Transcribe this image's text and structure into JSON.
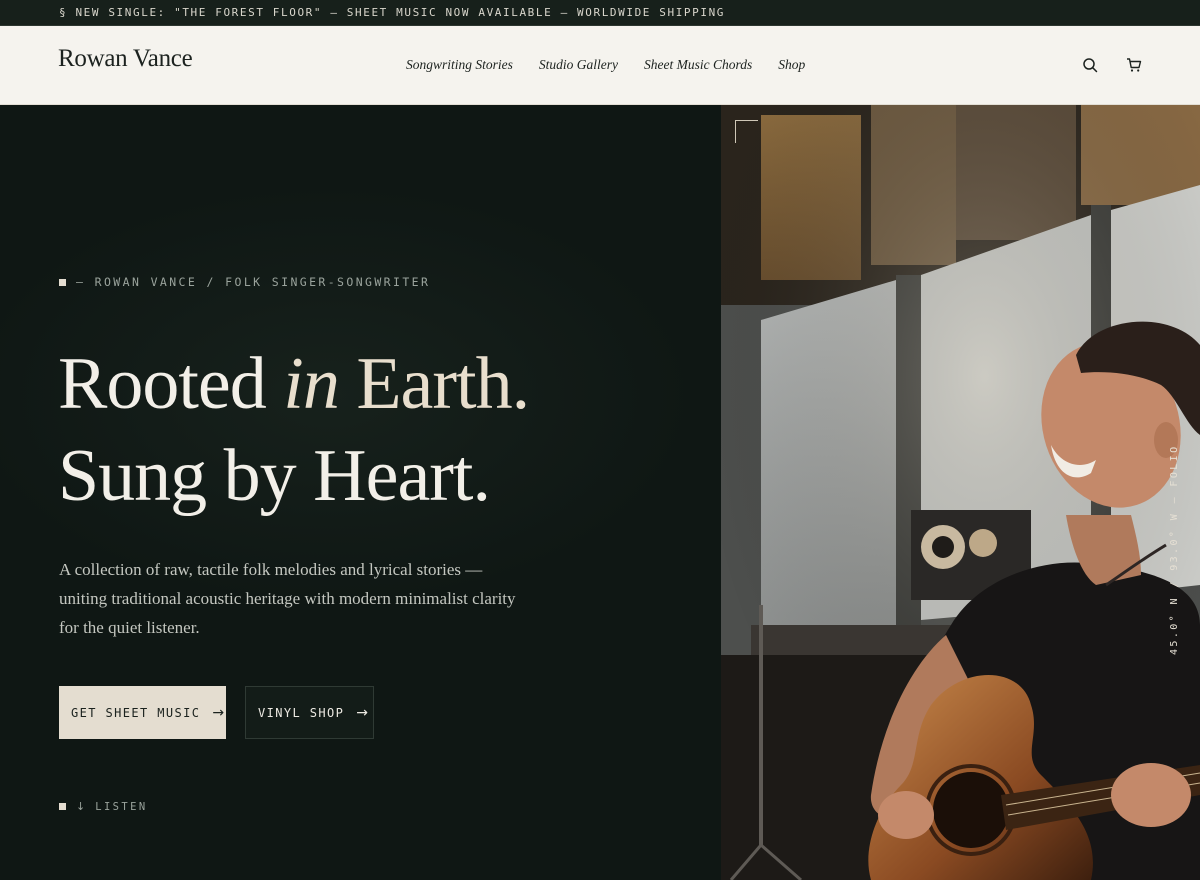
{
  "announcement": {
    "text": "§ NEW SINGLE: \"THE FOREST FLOOR\" — SHEET MUSIC NOW AVAILABLE — WORLDWIDE SHIPPING"
  },
  "header": {
    "logo": "Rowan Vance",
    "nav": [
      {
        "label": "Songwriting Stories"
      },
      {
        "label": "Studio Gallery"
      },
      {
        "label": "Sheet Music Chords"
      },
      {
        "label": "Shop"
      }
    ],
    "icons": [
      "search-icon",
      "cart-icon"
    ]
  },
  "hero": {
    "eyebrow": "— ROWAN VANCE / FOLK SINGER-SONGWRITER",
    "headline": {
      "line1_a": "Rooted ",
      "line1_em": "in",
      "line1_b": " Earth.",
      "line2": "Sung by Heart."
    },
    "lede": "A collection of raw, tactile folk melodies and lyrical stories — uniting traditional acoustic heritage with modern minimalist clarity for the quiet listener.",
    "primary_cta": "GET SHEET MUSIC",
    "secondary_cta": "VINYL SHOP",
    "listen": "LISTEN",
    "coordinates": "45.0° N / 93.0° W — FOLIO"
  },
  "colors": {
    "background": "#0f1714",
    "header_bg": "#f5f3ee",
    "accent": "#e4ddd0"
  }
}
